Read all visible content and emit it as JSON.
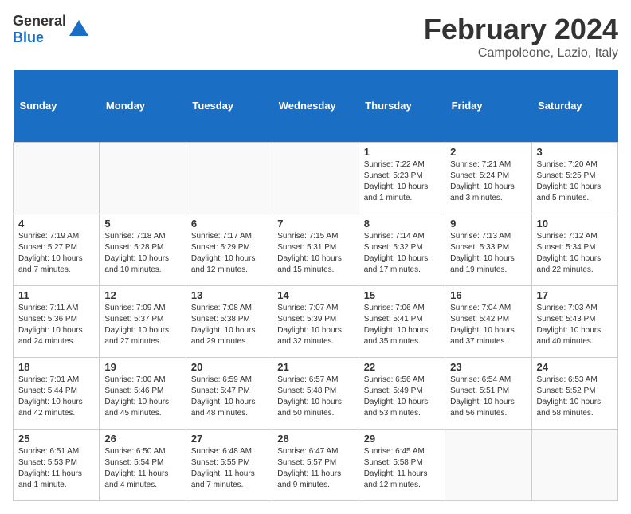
{
  "header": {
    "logo_general": "General",
    "logo_blue": "Blue",
    "title": "February 2024",
    "subtitle": "Campoleone, Lazio, Italy"
  },
  "weekdays": [
    "Sunday",
    "Monday",
    "Tuesday",
    "Wednesday",
    "Thursday",
    "Friday",
    "Saturday"
  ],
  "weeks": [
    [
      {
        "day": "",
        "info": ""
      },
      {
        "day": "",
        "info": ""
      },
      {
        "day": "",
        "info": ""
      },
      {
        "day": "",
        "info": ""
      },
      {
        "day": "1",
        "info": "Sunrise: 7:22 AM\nSunset: 5:23 PM\nDaylight: 10 hours\nand 1 minute."
      },
      {
        "day": "2",
        "info": "Sunrise: 7:21 AM\nSunset: 5:24 PM\nDaylight: 10 hours\nand 3 minutes."
      },
      {
        "day": "3",
        "info": "Sunrise: 7:20 AM\nSunset: 5:25 PM\nDaylight: 10 hours\nand 5 minutes."
      }
    ],
    [
      {
        "day": "4",
        "info": "Sunrise: 7:19 AM\nSunset: 5:27 PM\nDaylight: 10 hours\nand 7 minutes."
      },
      {
        "day": "5",
        "info": "Sunrise: 7:18 AM\nSunset: 5:28 PM\nDaylight: 10 hours\nand 10 minutes."
      },
      {
        "day": "6",
        "info": "Sunrise: 7:17 AM\nSunset: 5:29 PM\nDaylight: 10 hours\nand 12 minutes."
      },
      {
        "day": "7",
        "info": "Sunrise: 7:15 AM\nSunset: 5:31 PM\nDaylight: 10 hours\nand 15 minutes."
      },
      {
        "day": "8",
        "info": "Sunrise: 7:14 AM\nSunset: 5:32 PM\nDaylight: 10 hours\nand 17 minutes."
      },
      {
        "day": "9",
        "info": "Sunrise: 7:13 AM\nSunset: 5:33 PM\nDaylight: 10 hours\nand 19 minutes."
      },
      {
        "day": "10",
        "info": "Sunrise: 7:12 AM\nSunset: 5:34 PM\nDaylight: 10 hours\nand 22 minutes."
      }
    ],
    [
      {
        "day": "11",
        "info": "Sunrise: 7:11 AM\nSunset: 5:36 PM\nDaylight: 10 hours\nand 24 minutes."
      },
      {
        "day": "12",
        "info": "Sunrise: 7:09 AM\nSunset: 5:37 PM\nDaylight: 10 hours\nand 27 minutes."
      },
      {
        "day": "13",
        "info": "Sunrise: 7:08 AM\nSunset: 5:38 PM\nDaylight: 10 hours\nand 29 minutes."
      },
      {
        "day": "14",
        "info": "Sunrise: 7:07 AM\nSunset: 5:39 PM\nDaylight: 10 hours\nand 32 minutes."
      },
      {
        "day": "15",
        "info": "Sunrise: 7:06 AM\nSunset: 5:41 PM\nDaylight: 10 hours\nand 35 minutes."
      },
      {
        "day": "16",
        "info": "Sunrise: 7:04 AM\nSunset: 5:42 PM\nDaylight: 10 hours\nand 37 minutes."
      },
      {
        "day": "17",
        "info": "Sunrise: 7:03 AM\nSunset: 5:43 PM\nDaylight: 10 hours\nand 40 minutes."
      }
    ],
    [
      {
        "day": "18",
        "info": "Sunrise: 7:01 AM\nSunset: 5:44 PM\nDaylight: 10 hours\nand 42 minutes."
      },
      {
        "day": "19",
        "info": "Sunrise: 7:00 AM\nSunset: 5:46 PM\nDaylight: 10 hours\nand 45 minutes."
      },
      {
        "day": "20",
        "info": "Sunrise: 6:59 AM\nSunset: 5:47 PM\nDaylight: 10 hours\nand 48 minutes."
      },
      {
        "day": "21",
        "info": "Sunrise: 6:57 AM\nSunset: 5:48 PM\nDaylight: 10 hours\nand 50 minutes."
      },
      {
        "day": "22",
        "info": "Sunrise: 6:56 AM\nSunset: 5:49 PM\nDaylight: 10 hours\nand 53 minutes."
      },
      {
        "day": "23",
        "info": "Sunrise: 6:54 AM\nSunset: 5:51 PM\nDaylight: 10 hours\nand 56 minutes."
      },
      {
        "day": "24",
        "info": "Sunrise: 6:53 AM\nSunset: 5:52 PM\nDaylight: 10 hours\nand 58 minutes."
      }
    ],
    [
      {
        "day": "25",
        "info": "Sunrise: 6:51 AM\nSunset: 5:53 PM\nDaylight: 11 hours\nand 1 minute."
      },
      {
        "day": "26",
        "info": "Sunrise: 6:50 AM\nSunset: 5:54 PM\nDaylight: 11 hours\nand 4 minutes."
      },
      {
        "day": "27",
        "info": "Sunrise: 6:48 AM\nSunset: 5:55 PM\nDaylight: 11 hours\nand 7 minutes."
      },
      {
        "day": "28",
        "info": "Sunrise: 6:47 AM\nSunset: 5:57 PM\nDaylight: 11 hours\nand 9 minutes."
      },
      {
        "day": "29",
        "info": "Sunrise: 6:45 AM\nSunset: 5:58 PM\nDaylight: 11 hours\nand 12 minutes."
      },
      {
        "day": "",
        "info": ""
      },
      {
        "day": "",
        "info": ""
      }
    ]
  ]
}
